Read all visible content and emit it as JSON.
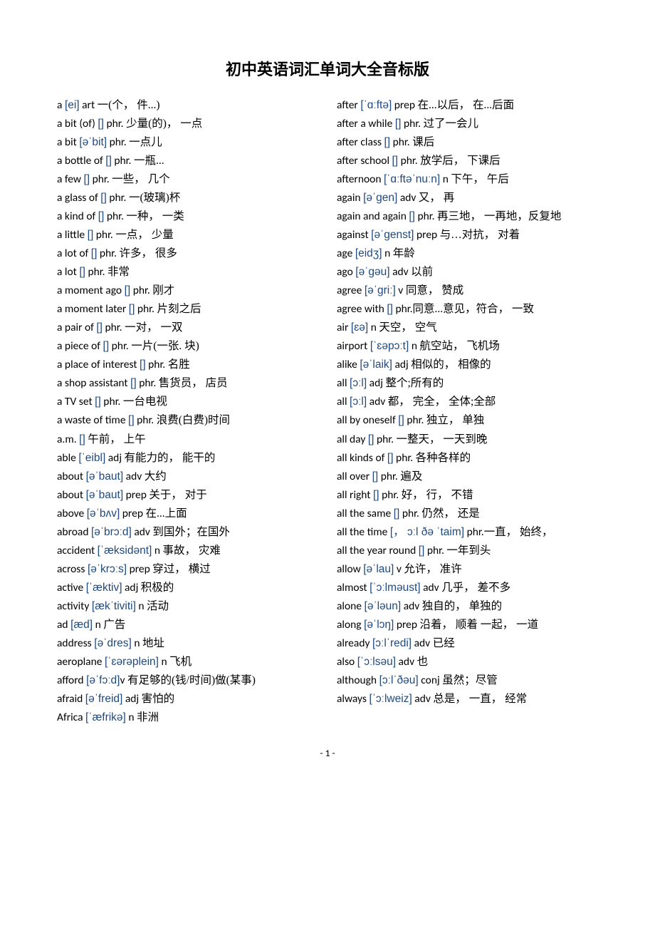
{
  "title": "初中英语词汇单词大全音标版",
  "page_number": "- 1 -",
  "entries": [
    {
      "word": "a ",
      "phon": "[ei]",
      "pos": " art ",
      "def": "一(个，  件...)"
    },
    {
      "word": "a bit (of) ",
      "phon": "[]",
      "pos": " phr. ",
      "def": "少量(的)，  一点"
    },
    {
      "word": "a bit ",
      "phon": "[əˈbit]",
      "pos": " phr. ",
      "def": "一点儿"
    },
    {
      "word": "a bottle of ",
      "phon": "[]",
      "pos": " phr. ",
      "def": "一瓶..."
    },
    {
      "word": "a few ",
      "phon": "[]",
      "pos": " phr. ",
      "def": "一些，  几个"
    },
    {
      "word": "a glass of ",
      "phon": "[]",
      "pos": " phr. ",
      "def": "一(玻璃)杯"
    },
    {
      "word": "a kind of ",
      "phon": "[]",
      "pos": " phr. ",
      "def": "一种，  一类"
    },
    {
      "word": "a little ",
      "phon": "[]",
      "pos": " phr. ",
      "def": "一点，  少量"
    },
    {
      "word": "a lot of ",
      "phon": "[]",
      "pos": " phr. ",
      "def": "许多，  很多"
    },
    {
      "word": "a lot ",
      "phon": "[]",
      "pos": " phr. ",
      "def": "非常"
    },
    {
      "word": "a moment ago ",
      "phon": "[]",
      "pos": " phr. ",
      "def": "刚才"
    },
    {
      "word": "a moment later ",
      "phon": "[]",
      "pos": " phr. ",
      "def": "片刻之后"
    },
    {
      "word": "a pair of ",
      "phon": "[]",
      "pos": " phr. ",
      "def": "一对，  一双"
    },
    {
      "word": "a piece of ",
      "phon": "[]",
      "pos": " phr. ",
      "def": "一片(一张. 块)"
    },
    {
      "word": "a place of interest ",
      "phon": "[]",
      "pos": " phr. ",
      "def": "名胜"
    },
    {
      "word": "a shop assistant ",
      "phon": "[]",
      "pos": " phr. ",
      "def": "售货员，  店员"
    },
    {
      "word": "a TV set ",
      "phon": "[]",
      "pos": " phr. ",
      "def": "一台电视"
    },
    {
      "word": "a waste of time ",
      "phon": "[]",
      "pos": " phr. ",
      "def": "浪费(白费)时间"
    },
    {
      "word": "a.m.  ",
      "phon": "[]",
      "pos": " ",
      "def": "午前，  上午"
    },
    {
      "word": "able ",
      "phon": "[ˈeibl]",
      "pos": " adj ",
      "def": "有能力的，  能干的"
    },
    {
      "word": "about ",
      "phon": "[əˈbaut]",
      "pos": " adv ",
      "def": "大约"
    },
    {
      "word": "about ",
      "phon": "[əˈbaut]",
      "pos": " prep ",
      "def": "关于，  对于"
    },
    {
      "word": "above ",
      "phon": "[əˈbʌv]",
      "pos": " prep ",
      "def": "在...上面"
    },
    {
      "word": "abroad ",
      "phon": "[əˈbrɔːd]",
      "pos": " adv ",
      "def": "到国外；在国外"
    },
    {
      "word": "accident ",
      "phon": "[ˈæksidənt]",
      "pos": " n ",
      "def": "事故，  灾难"
    },
    {
      "word": "across ",
      "phon": "[əˈkrɔːs]",
      "pos": " prep ",
      "def": "穿过，  横过"
    },
    {
      "word": "active ",
      "phon": "[ˈæktiv]",
      "pos": " adj ",
      "def": "积极的"
    },
    {
      "word": "activity ",
      "phon": "[ækˈtiviti]",
      "pos": " n ",
      "def": "活动"
    },
    {
      "word": "ad ",
      "phon": "[æd]",
      "pos": " n ",
      "def": "广告"
    },
    {
      "word": "address ",
      "phon": "[əˈdres]",
      "pos": " n ",
      "def": "地址"
    },
    {
      "word": "aeroplane ",
      "phon": "[ˈɛərəplein]",
      "pos": " n ",
      "def": "飞机"
    },
    {
      "word": "afford ",
      "phon": "[əˈfɔːd]",
      "pos": "v ",
      "def": "有足够的(钱/时间)做(某事)"
    },
    {
      "word": "afraid ",
      "phon": "[əˈfreid]",
      "pos": " adj ",
      "def": "害怕的"
    },
    {
      "word": "Africa ",
      "phon": "[ˈæfrikə]",
      "pos": " n ",
      "def": "非洲"
    },
    {
      "word": "after ",
      "phon": "[ˈɑːftə]",
      "pos": " prep ",
      "def": "在...以后，  在...后面"
    },
    {
      "word": "after a while ",
      "phon": "[]",
      "pos": " phr. ",
      "def": "过了一会儿"
    },
    {
      "word": "after class ",
      "phon": "[]",
      "pos": " phr. ",
      "def": "课后"
    },
    {
      "word": "after school ",
      "phon": "[]",
      "pos": " phr. ",
      "def": "放学后，  下课后"
    },
    {
      "word": "afternoon ",
      "phon": "[ˈɑːftəˈnuːn]",
      "pos": " n ",
      "def": "下午，  午后"
    },
    {
      "word": "again ",
      "phon": "[əˈgen]",
      "pos": " adv ",
      "def": "又，  再"
    },
    {
      "word": "again and again  ",
      "phon": "[]",
      "pos": " phr. ",
      "def": "再三地，  一再地，反复地"
    },
    {
      "word": "against ",
      "phon": "[əˈgenst]",
      "pos": " prep ",
      "def": "与…对抗，  对着"
    },
    {
      "word": "age ",
      "phon": "[eidʒ]",
      "pos": " n ",
      "def": "年龄"
    },
    {
      "word": "ago ",
      "phon": "[əˈgəu]",
      "pos": " adv ",
      "def": "以前"
    },
    {
      "word": "agree ",
      "phon": "[əˈgriː]",
      "pos": " v ",
      "def": "同意，  赞成"
    },
    {
      "word": "agree with  ",
      "phon": "[]",
      "pos": " phr.",
      "def": "同意...意见，符合，  一致"
    },
    {
      "word": "air ",
      "phon": "[ɛə]",
      "pos": " n ",
      "def": "天空，  空气"
    },
    {
      "word": "airport ",
      "phon": "[ˈɛəpɔːt]",
      "pos": " n ",
      "def": "航空站，  飞机场"
    },
    {
      "word": "alike ",
      "phon": "[əˈlaik]",
      "pos": " adj ",
      "def": "相似的，  相像的"
    },
    {
      "word": "all ",
      "phon": "[ɔːl]",
      "pos": " adj ",
      "def": "整个;所有的"
    },
    {
      "word": "all ",
      "phon": "[ɔːl]",
      "pos": " adv ",
      "def": "都，  完全，  全体;全部"
    },
    {
      "word": "all by oneself ",
      "phon": "[]",
      "pos": " phr. ",
      "def": "独立，  单独"
    },
    {
      "word": "all day ",
      "phon": "[]",
      "pos": " phr. ",
      "def": "一整天，  一天到晚"
    },
    {
      "word": "all kinds of ",
      "phon": "[]",
      "pos": " phr. ",
      "def": "各种各样的"
    },
    {
      "word": "all over ",
      "phon": "[]",
      "pos": " phr. ",
      "def": "遍及"
    },
    {
      "word": "all right  ",
      "phon": "[]",
      "pos": " phr. ",
      "def": "好，  行，  不错"
    },
    {
      "word": "all the same ",
      "phon": "[]",
      "pos": " phr. ",
      "def": "仍然，  还是"
    },
    {
      "word": "all the time ",
      "phon": "[，  ɔːl ðə ˈtaim]",
      "pos": " phr.",
      "def": "一直，  始终，"
    },
    {
      "word": "all the year round ",
      "phon": "[]",
      "pos": " phr. ",
      "def": "一年到头"
    },
    {
      "word": "allow ",
      "phon": "[əˈlau]",
      "pos": " v ",
      "def": "允许，  准许"
    },
    {
      "word": "almost ",
      "phon": "[ˈɔːlməust]",
      "pos": " adv ",
      "def": "几乎，  差不多"
    },
    {
      "word": "alone ",
      "phon": "[əˈləun]",
      "pos": " adv ",
      "def": "独自的，  单独的"
    },
    {
      "word": "along ",
      "phon": "[əˈlɔŋ]",
      "pos": " prep ",
      "def": "沿着，  顺着 一起，  一道"
    },
    {
      "word": "already ",
      "phon": "[ɔːlˈredi]",
      "pos": " adv ",
      "def": "已经"
    },
    {
      "word": "also ",
      "phon": "[ˈɔːlsəu]",
      "pos": " adv ",
      "def": "也"
    },
    {
      "word": "although ",
      "phon": "[ɔːlˈðəu]",
      "pos": " conj ",
      "def": "虽然；尽管"
    },
    {
      "word": "always ",
      "phon": "[ˈɔːlweiz]",
      "pos": " adv ",
      "def": "总是，  一直，  经常"
    }
  ]
}
